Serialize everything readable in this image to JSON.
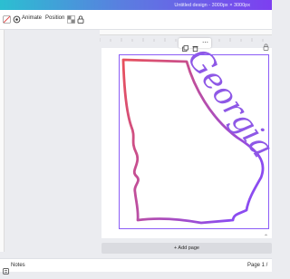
{
  "header": {
    "document_title": "Untitled design - 3000px × 3000px"
  },
  "toolbar": {
    "animate_label": "Animate",
    "position_label": "Position"
  },
  "canvas": {
    "artwork_text": "Georgia",
    "add_page_label": "+ Add page"
  },
  "footer": {
    "notes_label": "Notes",
    "page_indicator": "Page 1 /"
  },
  "colors": {
    "gradient_start": "#e8505b",
    "gradient_end": "#8b4cf0",
    "selection": "#8b5cf6",
    "topbar_start": "#2bbfd1",
    "topbar_end": "#7d3ff0"
  }
}
